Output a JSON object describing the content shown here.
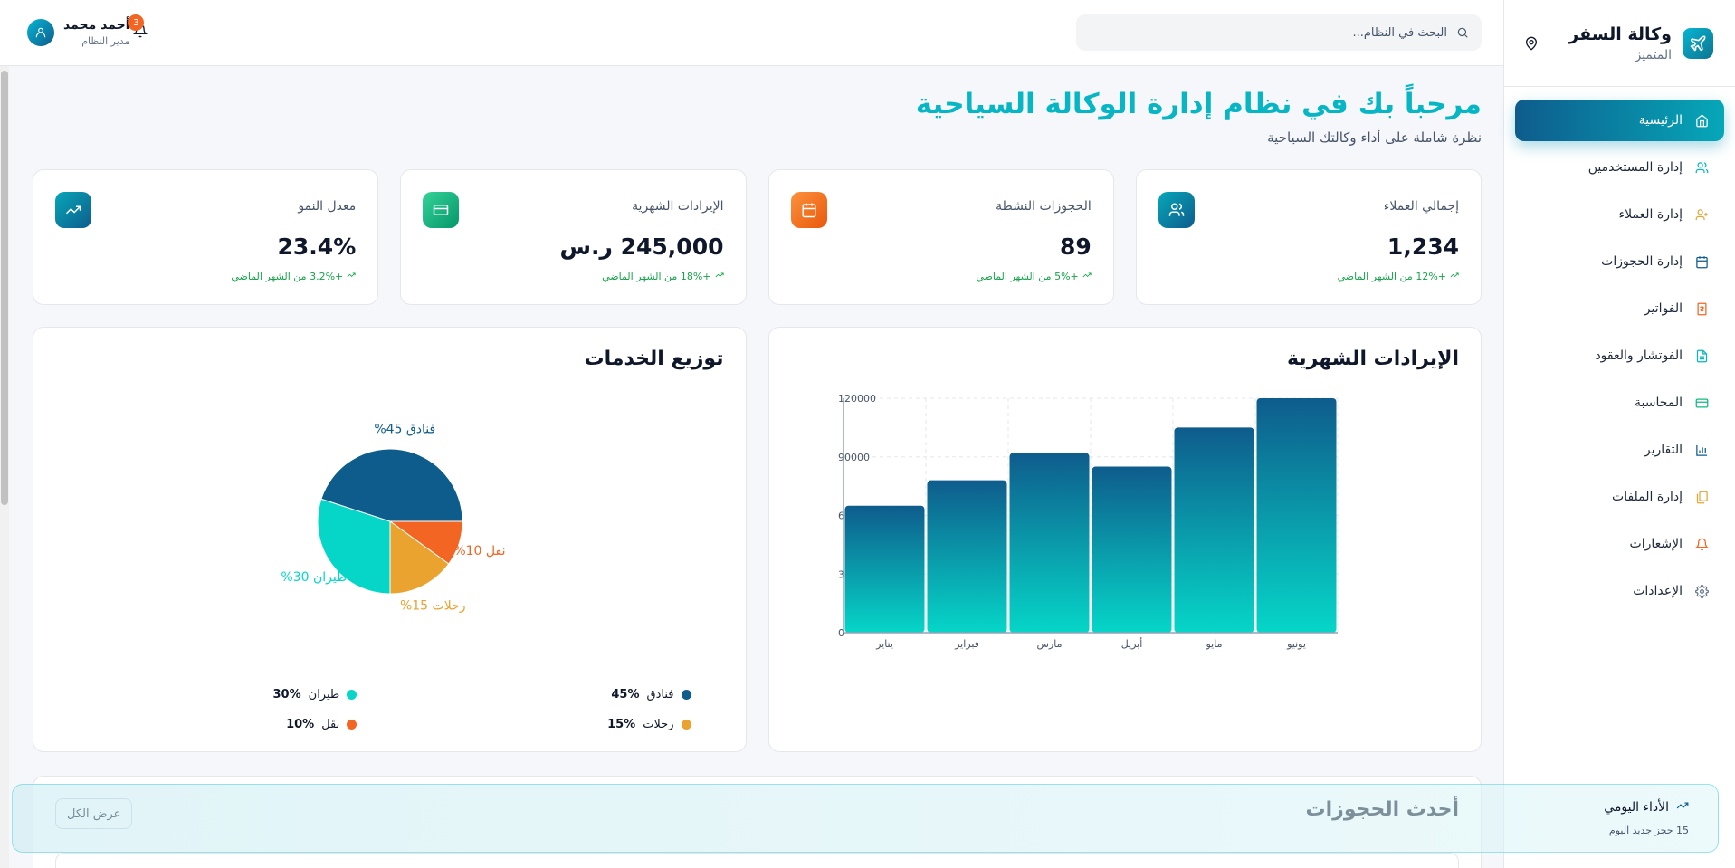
{
  "brand": {
    "name": "وكالة السفر",
    "subtitle": "المتميز"
  },
  "sidebar": {
    "items": [
      {
        "label": "الرئيسية",
        "icon": "home-icon",
        "active": true
      },
      {
        "label": "إدارة المستخدمين",
        "icon": "users-icon"
      },
      {
        "label": "إدارة العملاء",
        "icon": "user-plus-icon"
      },
      {
        "label": "إدارة الحجوزات",
        "icon": "calendar-icon"
      },
      {
        "label": "الفواتير",
        "icon": "receipt-icon"
      },
      {
        "label": "الفوتشار والعقود",
        "icon": "document-icon"
      },
      {
        "label": "المحاسبة",
        "icon": "credit-card-icon"
      },
      {
        "label": "التقارير",
        "icon": "bar-chart-icon"
      },
      {
        "label": "إدارة الملفات",
        "icon": "files-icon"
      },
      {
        "label": "الإشعارات",
        "icon": "bell-icon"
      },
      {
        "label": "الإعدادات",
        "icon": "gear-icon"
      }
    ]
  },
  "header": {
    "search_placeholder": "البحث في النظام...",
    "notification_count": "3",
    "user_name": "أحمد محمد",
    "user_role": "مدير النظام"
  },
  "page": {
    "title": "مرحباً بك في نظام إدارة الوكالة السياحية",
    "subtitle": "نظرة شاملة على أداء وكالتك السياحية"
  },
  "stats": [
    {
      "label": "إجمالي العملاء",
      "value": "1,234",
      "change": "+12% من الشهر الماضي",
      "icon": "users-icon",
      "color": "#0e7490"
    },
    {
      "label": "الحجوزات النشطة",
      "value": "89",
      "change": "+5% من الشهر الماضي",
      "icon": "calendar-icon",
      "color": "#f97316"
    },
    {
      "label": "الإيرادات الشهرية",
      "value": "245,000 ر.س",
      "change": "+18% من الشهر الماضي",
      "icon": "credit-card-icon",
      "color": "#10b981"
    },
    {
      "label": "معدل النمو",
      "value": "23.4%",
      "change": "+3.2% من الشهر الماضي",
      "icon": "trending-up-icon",
      "color": "#0e7490"
    }
  ],
  "revenue_title": "الإيرادات الشهرية",
  "services_title": "توزيع الخدمات",
  "chart_data": [
    {
      "type": "bar",
      "title": "الإيرادات الشهرية",
      "categories": [
        "يناير",
        "فبراير",
        "مارس",
        "أبريل",
        "مايو",
        "يونيو"
      ],
      "values": [
        65000,
        78000,
        92000,
        85000,
        105000,
        120000
      ],
      "yticks": [
        "0",
        "30000",
        "60000",
        "90000",
        "120000"
      ],
      "ylim": [
        0,
        120000
      ],
      "grid": true
    },
    {
      "type": "pie",
      "title": "توزيع الخدمات",
      "slices": [
        {
          "name": "فنادق",
          "value": 45,
          "color": "#0e5c8c",
          "label": "فنادق 45%"
        },
        {
          "name": "نقل",
          "value": 10,
          "color": "#f26522",
          "label": "نقل 10%"
        },
        {
          "name": "رحلات",
          "value": 15,
          "color": "#eba330",
          "label": "رحلات 15%"
        },
        {
          "name": "طيران",
          "value": 30,
          "color": "#06d6c8",
          "label": "طيران 30%"
        }
      ]
    }
  ],
  "legend": [
    {
      "name": "فنادق",
      "pct": "45%",
      "color": "#0e5c8c"
    },
    {
      "name": "طيران",
      "pct": "30%",
      "color": "#06d6c8"
    },
    {
      "name": "رحلات",
      "pct": "15%",
      "color": "#eba330"
    },
    {
      "name": "نقل",
      "pct": "10%",
      "color": "#f26522"
    }
  ],
  "recent": {
    "title": "أحدث الحجوزات",
    "view_all": "عرض الكل"
  },
  "daily": {
    "title": "الأداء اليومي",
    "subtitle": "15 حجز جديد اليوم"
  }
}
